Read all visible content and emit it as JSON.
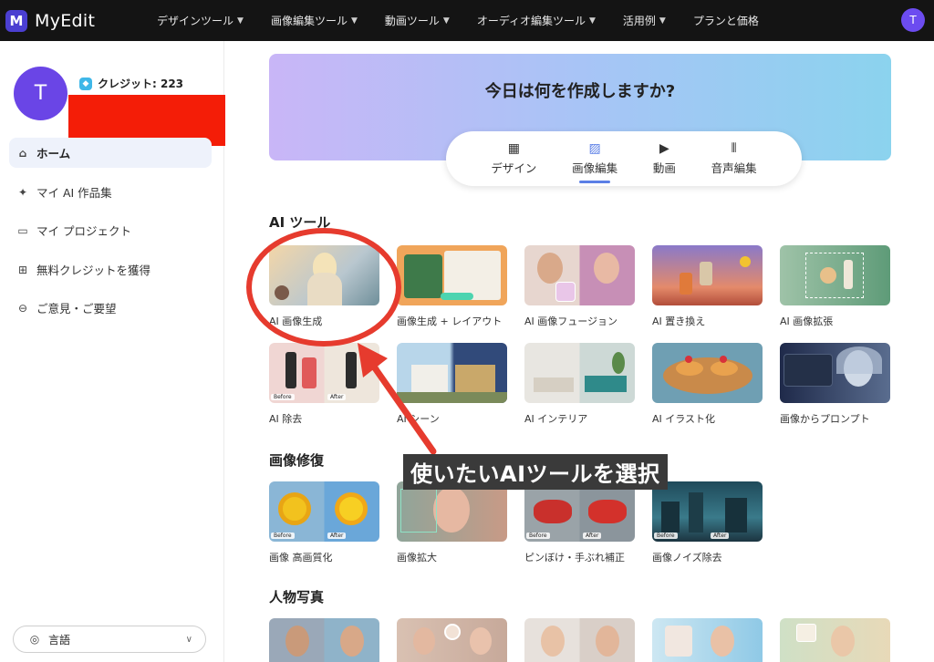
{
  "app": {
    "logo_mark": "M",
    "logo_text": "MyEdit",
    "user_initial": "T"
  },
  "nav": [
    {
      "label": "デザインツール",
      "chevron": true
    },
    {
      "label": "画像編集ツール",
      "chevron": true
    },
    {
      "label": "動画ツール",
      "chevron": true
    },
    {
      "label": "オーディオ編集ツール",
      "chevron": true
    },
    {
      "label": "活用例",
      "chevron": true
    },
    {
      "label": "プランと価格",
      "chevron": false
    }
  ],
  "sidebar": {
    "avatar_initial": "T",
    "credit_label": "クレジット: 223",
    "items": [
      {
        "label": "ホーム",
        "icon": "home-icon",
        "active": true
      },
      {
        "label": "マイ AI 作品集",
        "icon": "sparkle-icon",
        "active": false
      },
      {
        "label": "マイ プロジェクト",
        "icon": "folder-icon",
        "active": false
      },
      {
        "label": "無料クレジットを獲得",
        "icon": "gift-icon",
        "active": false
      },
      {
        "label": "ご意見・ご要望",
        "icon": "feedback-icon",
        "active": false
      }
    ],
    "language_label": "言語"
  },
  "hero": {
    "title": "今日は何を作成しますか?",
    "tabs": [
      {
        "label": "デザイン",
        "icon": "design-icon",
        "active": false
      },
      {
        "label": "画像編集",
        "icon": "image-icon",
        "active": true
      },
      {
        "label": "動画",
        "icon": "video-icon",
        "active": false
      },
      {
        "label": "音声編集",
        "icon": "audio-icon",
        "active": false
      }
    ]
  },
  "sections": {
    "ai_tools": {
      "title": "AI ツール",
      "cards": [
        {
          "label": "AI 画像生成"
        },
        {
          "label": "画像生成 + レイアウト"
        },
        {
          "label": "AI 画像フュージョン"
        },
        {
          "label": "AI 置き換え"
        },
        {
          "label": "AI 画像拡張"
        },
        {
          "label": "AI 除去",
          "before": "Before",
          "after": "After"
        },
        {
          "label": "AI シーン"
        },
        {
          "label": "AI インテリア"
        },
        {
          "label": "AI イラスト化"
        },
        {
          "label": "画像からプロンプト"
        }
      ]
    },
    "restore": {
      "title": "画像修復",
      "cards": [
        {
          "label": "画像 高画質化",
          "before": "Before",
          "after": "After"
        },
        {
          "label": "画像拡大"
        },
        {
          "label": "ピンぼけ・手ぶれ補正",
          "before": "Before",
          "after": "After"
        },
        {
          "label": "画像ノイズ除去",
          "before": "Before",
          "after": "After"
        }
      ]
    },
    "portrait": {
      "title": "人物写真"
    }
  },
  "annotation": {
    "text": "使いたいAIツールを選択"
  },
  "colors": {
    "accent": "#5b7fe6",
    "annotation_red": "#e63b2e",
    "redaction": "#f41d07",
    "nav_bg": "#141414"
  }
}
